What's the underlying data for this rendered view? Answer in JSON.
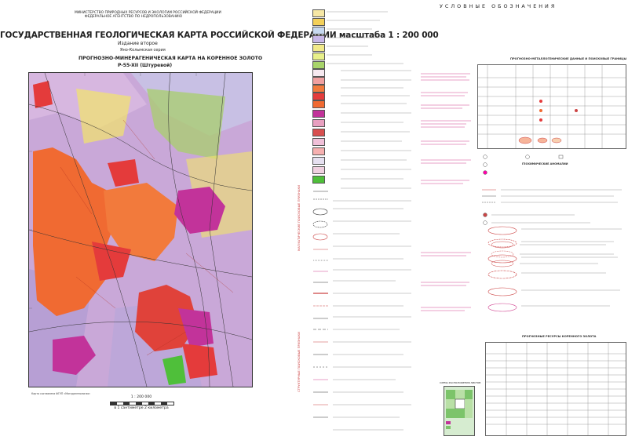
{
  "header": {
    "ministry_lines": [
      "МИНИСТЕРСТВО ПРИРОДНЫХ РЕСУРСОВ И ЭКОЛОГИИ РОССИЙСКОЙ ФЕДЕРАЦИИ",
      "ФЕДЕРАЛЬНОЕ АГЕНТСТВО ПО НЕДРОПОЛЬЗОВАНИЮ"
    ],
    "title": "ГОСУДАРСТВЕННАЯ ГЕОЛОГИЧЕСКАЯ КАРТА РОССИЙСКОЙ ФЕДЕРАЦИИ масштаба 1 : 200 000",
    "edition": "Издание второе",
    "series": "Яно-Колымская серия",
    "map_title": "ПРОГНОЗНО-МИНЕРАГЕНИЧЕСКАЯ КАРТА НА КОРЕННОЕ ЗОЛОТО",
    "sheet": "P-55-XII (Штуревой)"
  },
  "legend": {
    "title": "УСЛОВНЫЕ ОБОЗНАЧЕНИЯ",
    "side_labels": [
      "МАГМАТИЧЕСКИЕ ПОИСКОВЫЕ ПРИЗНАКИ",
      "СТРУКТУРНЫЕ ПОИСКОВЫЕ ПРИЗНАКИ"
    ],
    "section_right_1": "ПРОГНОЗНО-МЕТАЛЛОГЕНИЧЕСКИЕ ДАННЫЕ И ПОИСКОВЫЕ ГРАНИЦЫ",
    "section_right_2": "ГЕОХИМИЧЕСКИЕ АНОМАЛИИ",
    "section_right_3": "ПРОГНОЗНЫЕ РЕСУРСЫ КОРЕННОГО ЗОЛОТА",
    "inset_title": "СХЕМА РАСПОЛОЖЕНИЯ ЛИСТОВ"
  },
  "scale": {
    "ratio": "1 : 200 000",
    "note": "в 1 сантиметре 2 километра"
  },
  "imprint": "Карта составлена ФГУП «Магадангеология»",
  "colors": {
    "red_text": "#c44444",
    "pink_text": "#d0418f",
    "granite_orange": "#f06a32",
    "granite_red": "#e43b3b",
    "intrusion_magenta": "#c2339a",
    "background_lilac": "#c9a8d8",
    "sediment_yellow": "#f2e46b",
    "sediment_green": "#a8cf6c"
  }
}
